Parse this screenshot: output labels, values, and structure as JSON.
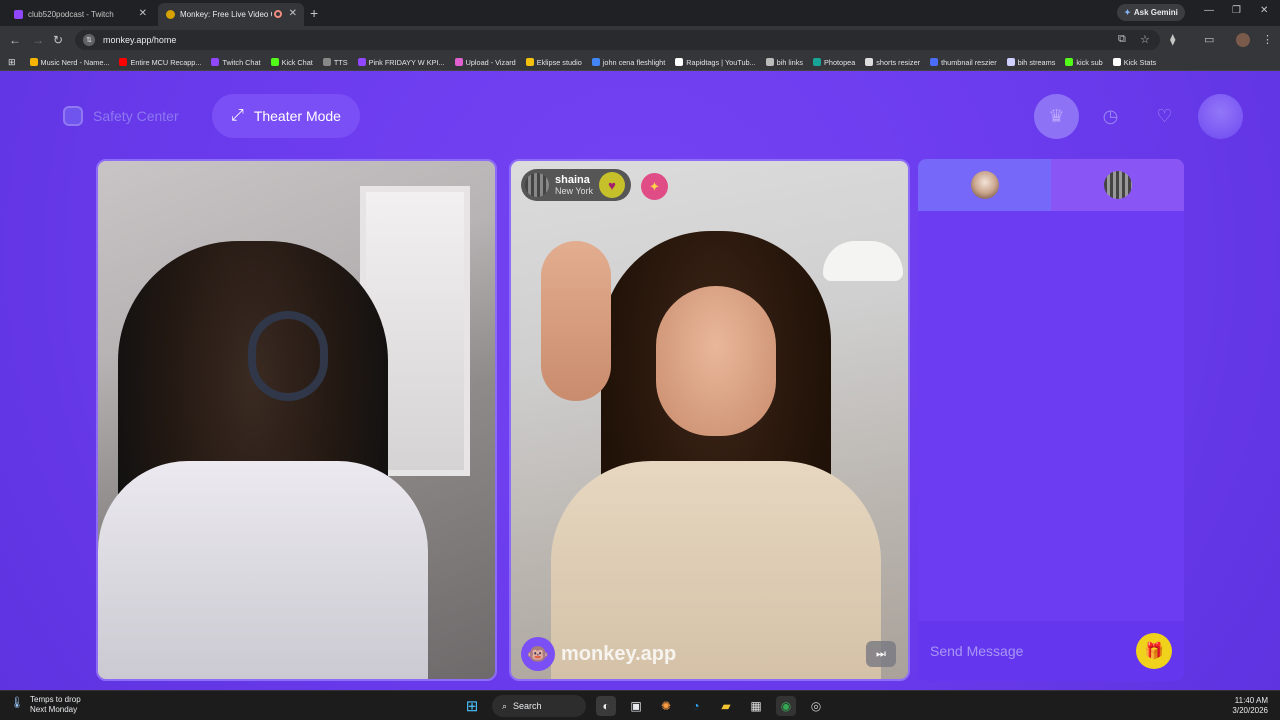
{
  "browser": {
    "tabs": [
      {
        "title": "club520podcast - Twitch",
        "active": false,
        "favicon_color": "#9146ff"
      },
      {
        "title": "Monkey: Free Live Video Ch",
        "active": true,
        "favicon_color": "#d8a200"
      }
    ],
    "ask_gemini": "Ask Gemini",
    "url": "monkey.app/home",
    "bookmarks": [
      {
        "label": "Music Nerd - Name...",
        "color": "#f4b400"
      },
      {
        "label": "Entire MCU Recapp...",
        "color": "#ff0000"
      },
      {
        "label": "Twitch Chat",
        "color": "#9146ff"
      },
      {
        "label": "Kick Chat",
        "color": "#53fc18"
      },
      {
        "label": "TTS",
        "color": "#888888"
      },
      {
        "label": "Pink FRIDAYY W KPI...",
        "color": "#9146ff"
      },
      {
        "label": "Upload - Vizard",
        "color": "#e060d0"
      },
      {
        "label": "Eklipse studio",
        "color": "#f4c20d"
      },
      {
        "label": "john cena fleshlight",
        "color": "#4285f4"
      },
      {
        "label": "Rapidtags | YouTub...",
        "color": "#ffffff"
      },
      {
        "label": "bih links",
        "color": "#bbbbbb"
      },
      {
        "label": "Photopea",
        "color": "#18a497"
      },
      {
        "label": "shorts resizer",
        "color": "#dddddd"
      },
      {
        "label": "thumbnail reszier",
        "color": "#4a6cf7"
      },
      {
        "label": "bih streams",
        "color": "#d0d0ff"
      },
      {
        "label": "kick sub",
        "color": "#53fc18"
      },
      {
        "label": "Kick Stats",
        "color": "#ffffff"
      }
    ]
  },
  "header": {
    "safety_center": "Safety Center",
    "theater_mode": "Theater Mode"
  },
  "call": {
    "remote_user": {
      "name": "shaina",
      "location": "New York"
    },
    "watermark": "monkey.app"
  },
  "chat": {
    "placeholder": "Send Message"
  },
  "taskbar": {
    "weather_title": "Temps to drop",
    "weather_sub": "Next Monday",
    "search": "Search",
    "time": "11:40 AM",
    "date": "3/20/2026"
  },
  "colors": {
    "page_bg": "#6a3bed",
    "accent": "#7b4ff6",
    "gift": "#f0d21c"
  }
}
